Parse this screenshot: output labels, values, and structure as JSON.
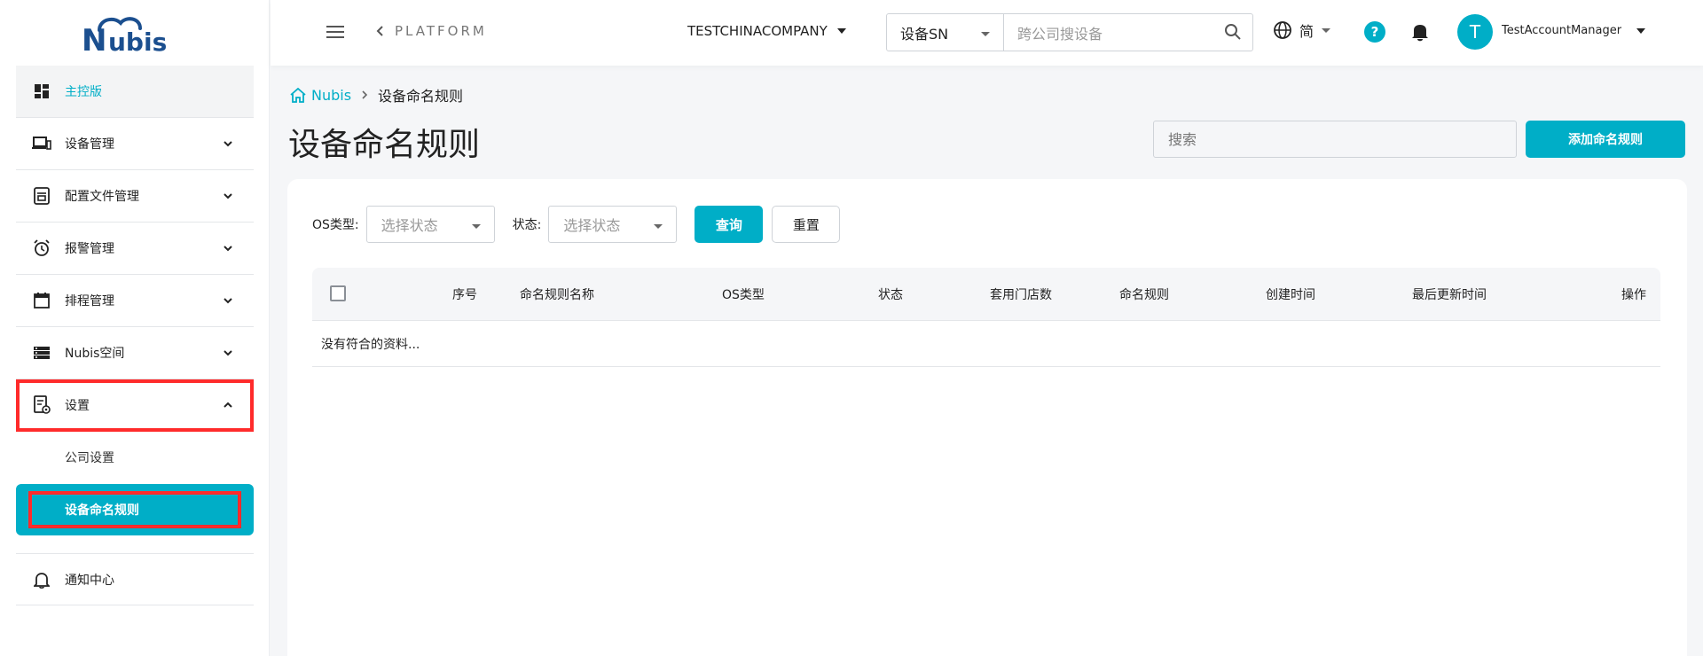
{
  "sidebar": {
    "logo_text": "Nubis",
    "items": [
      {
        "label": "主控版",
        "icon": "dashboard-icon"
      },
      {
        "label": "设备管理",
        "icon": "devices-icon"
      },
      {
        "label": "配置文件管理",
        "icon": "config-file-icon"
      },
      {
        "label": "报警管理",
        "icon": "alarm-icon"
      },
      {
        "label": "排程管理",
        "icon": "calendar-icon"
      },
      {
        "label": "Nubis空间",
        "icon": "storage-icon"
      },
      {
        "label": "设置",
        "icon": "settings-doc-icon"
      },
      {
        "label": "通知中心",
        "icon": "bell-icon"
      }
    ],
    "settings_sub": [
      {
        "label": "公司设置"
      },
      {
        "label": "设备命名规则"
      }
    ]
  },
  "topbar": {
    "platform_label": "PLATFORM",
    "company": "TESTCHINACOMPANY",
    "search_type": "设备SN",
    "search_placeholder": "跨公司搜设备",
    "language": "简",
    "help_glyph": "?",
    "avatar_letter": "T",
    "account_name": "TestAccountManager"
  },
  "breadcrumb": {
    "home": "Nubis",
    "current": "设备命名规则"
  },
  "page": {
    "title": "设备命名规则",
    "search_placeholder": "搜索",
    "add_button": "添加命名规则"
  },
  "filters": {
    "os_label": "OS类型:",
    "os_placeholder": "选择状态",
    "status_label": "状态:",
    "status_placeholder": "选择状态",
    "query_button": "查询",
    "reset_button": "重置"
  },
  "table": {
    "columns": [
      "序号",
      "命名规则名称",
      "OS类型",
      "状态",
      "套用门店数",
      "命名规则",
      "创建时间",
      "最后更新时间",
      "操作"
    ],
    "empty_text": "没有符合的资料..."
  },
  "colors": {
    "accent": "#00aec7",
    "highlight": "#ff2b2b"
  }
}
